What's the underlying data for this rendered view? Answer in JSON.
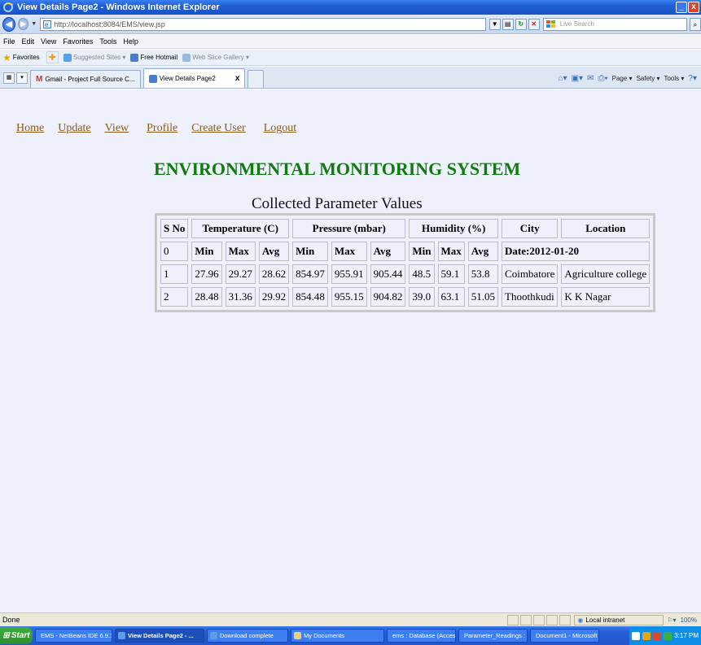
{
  "window": {
    "title": "View Details Page2 - Windows Internet Explorer",
    "min": "_",
    "close": "x"
  },
  "address": {
    "url": "http://localhost:8084/EMS/view.jsp",
    "search_placeholder": "Live Search"
  },
  "menu": [
    "File",
    "Edit",
    "View",
    "Favorites",
    "Tools",
    "Help"
  ],
  "favorites": {
    "label": "Favorites",
    "items": [
      {
        "label": "Suggested Sites ▾"
      },
      {
        "label": "Free Hotmail"
      },
      {
        "label": "Web Slice Gallery ▾"
      }
    ]
  },
  "tabs": [
    {
      "label": "Gmail - Project Full Source C..."
    },
    {
      "label": "View Details Page2"
    }
  ],
  "command_bar": {
    "page": "Page ▾",
    "safety": "Safety ▾",
    "tools": "Tools ▾"
  },
  "nav_links": [
    "Home",
    "Update",
    "View",
    "Profile",
    "Create User",
    "Logout"
  ],
  "system_title": "ENVIRONMENTAL MONITORING SYSTEM",
  "table_title": "Collected Parameter Values",
  "table": {
    "headers": {
      "sno": "S No",
      "temp": "Temperature (C)",
      "pressure": "Pressure (mbar)",
      "humidity": "Humidity (%)",
      "city": "City",
      "location": "Location"
    },
    "sub_row": {
      "sno": "0",
      "min": "Min",
      "max": "Max",
      "avg": "Avg",
      "date": "Date:2012-01-20"
    },
    "rows": [
      {
        "sno": "1",
        "t_min": "27.96",
        "t_max": "29.27",
        "t_avg": "28.62",
        "p_min": "854.97",
        "p_max": "955.91",
        "p_avg": "905.44",
        "h_min": "48.5",
        "h_max": "59.1",
        "h_avg": "53.8",
        "city": "Coimbatore",
        "location": "Agriculture college"
      },
      {
        "sno": "2",
        "t_min": "28.48",
        "t_max": "31.36",
        "t_avg": "29.92",
        "p_min": "854.48",
        "p_max": "955.15",
        "p_avg": "904.82",
        "h_min": "39.0",
        "h_max": "63.1",
        "h_avg": "51.05",
        "city": "Thoothkudi",
        "location": "K K Nagar"
      }
    ]
  },
  "status": {
    "text": "Done",
    "zone": "Local intranet",
    "zoom": "100%"
  },
  "taskbar": {
    "start": "Start",
    "tasks": [
      "EMS - NetBeans IDE 6.9.1",
      "View Details Page2 - ...",
      "Download complete",
      "My Documents",
      "ems : Database (Access ...",
      "Parameter_Readings : T...",
      "Document1 - Microsoft ..."
    ],
    "clock": "3:17 PM"
  }
}
